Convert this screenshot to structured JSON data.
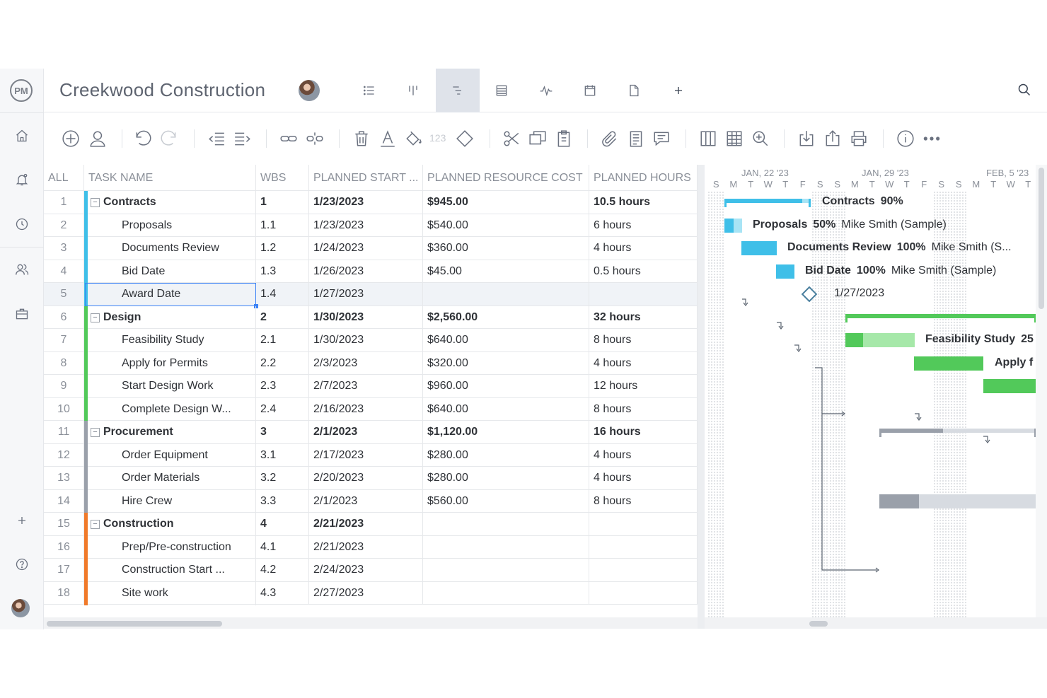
{
  "header": {
    "project_title": "Creekwood Construction"
  },
  "view_tabs": [
    {
      "name": "list-view-icon",
      "active": false
    },
    {
      "name": "board-view-icon",
      "active": false
    },
    {
      "name": "gantt-view-icon",
      "active": true
    },
    {
      "name": "sheet-view-icon",
      "active": false
    },
    {
      "name": "dashboard-view-icon",
      "active": false
    },
    {
      "name": "calendar-view-icon",
      "active": false
    },
    {
      "name": "files-view-icon",
      "active": false
    },
    {
      "name": "add-view-icon",
      "active": false
    }
  ],
  "toolbar": {
    "number_format_label": "123"
  },
  "grid": {
    "columns": [
      "ALL",
      "TASK NAME",
      "WBS",
      "PLANNED START ...",
      "PLANNED RESOURCE COST",
      "PLANNED HOURS"
    ],
    "rows": [
      {
        "num": "1",
        "name": "Contracts",
        "wbs": "1",
        "start": "1/23/2023",
        "cost": "$945.00",
        "hours": "10.5 hours",
        "group": true,
        "color": "#3fbfe8"
      },
      {
        "num": "2",
        "name": "Proposals",
        "wbs": "1.1",
        "start": "1/23/2023",
        "cost": "$540.00",
        "hours": "6 hours",
        "group": false,
        "color": "#3fbfe8"
      },
      {
        "num": "3",
        "name": "Documents Review",
        "wbs": "1.2",
        "start": "1/24/2023",
        "cost": "$360.00",
        "hours": "4 hours",
        "group": false,
        "color": "#3fbfe8"
      },
      {
        "num": "4",
        "name": "Bid Date",
        "wbs": "1.3",
        "start": "1/26/2023",
        "cost": "$45.00",
        "hours": "0.5 hours",
        "group": false,
        "color": "#3fbfe8"
      },
      {
        "num": "5",
        "name": "Award Date",
        "wbs": "1.4",
        "start": "1/27/2023",
        "cost": "",
        "hours": "",
        "group": false,
        "color": "#3fbfe8",
        "selected": true
      },
      {
        "num": "6",
        "name": "Design",
        "wbs": "2",
        "start": "1/30/2023",
        "cost": "$2,560.00",
        "hours": "32 hours",
        "group": true,
        "color": "#52c95a"
      },
      {
        "num": "7",
        "name": "Feasibility Study",
        "wbs": "2.1",
        "start": "1/30/2023",
        "cost": "$640.00",
        "hours": "8 hours",
        "group": false,
        "color": "#52c95a"
      },
      {
        "num": "8",
        "name": "Apply for Permits",
        "wbs": "2.2",
        "start": "2/3/2023",
        "cost": "$320.00",
        "hours": "4 hours",
        "group": false,
        "color": "#52c95a"
      },
      {
        "num": "9",
        "name": "Start Design Work",
        "wbs": "2.3",
        "start": "2/7/2023",
        "cost": "$960.00",
        "hours": "12 hours",
        "group": false,
        "color": "#52c95a"
      },
      {
        "num": "10",
        "name": "Complete Design W...",
        "wbs": "2.4",
        "start": "2/16/2023",
        "cost": "$640.00",
        "hours": "8 hours",
        "group": false,
        "color": "#52c95a"
      },
      {
        "num": "11",
        "name": "Procurement",
        "wbs": "3",
        "start": "2/1/2023",
        "cost": "$1,120.00",
        "hours": "16 hours",
        "group": true,
        "color": "#9aa0aa"
      },
      {
        "num": "12",
        "name": "Order Equipment",
        "wbs": "3.1",
        "start": "2/17/2023",
        "cost": "$280.00",
        "hours": "4 hours",
        "group": false,
        "color": "#9aa0aa"
      },
      {
        "num": "13",
        "name": "Order Materials",
        "wbs": "3.2",
        "start": "2/20/2023",
        "cost": "$280.00",
        "hours": "4 hours",
        "group": false,
        "color": "#9aa0aa"
      },
      {
        "num": "14",
        "name": "Hire Crew",
        "wbs": "3.3",
        "start": "2/1/2023",
        "cost": "$560.00",
        "hours": "8 hours",
        "group": false,
        "color": "#9aa0aa"
      },
      {
        "num": "15",
        "name": "Construction",
        "wbs": "4",
        "start": "2/21/2023",
        "cost": "",
        "hours": "",
        "group": true,
        "color": "#f07a2a"
      },
      {
        "num": "16",
        "name": "Prep/Pre-construction",
        "wbs": "4.1",
        "start": "2/21/2023",
        "cost": "",
        "hours": "",
        "group": false,
        "color": "#f07a2a"
      },
      {
        "num": "17",
        "name": "Construction Start ...",
        "wbs": "4.2",
        "start": "2/24/2023",
        "cost": "",
        "hours": "",
        "group": false,
        "color": "#f07a2a"
      },
      {
        "num": "18",
        "name": "Site work",
        "wbs": "4.3",
        "start": "2/27/2023",
        "cost": "",
        "hours": "",
        "group": false,
        "color": "#f07a2a"
      }
    ]
  },
  "gantt": {
    "weeks": [
      "JAN, 22 '23",
      "JAN, 29 '23",
      "FEB, 5 '23"
    ],
    "days": [
      "S",
      "M",
      "T",
      "W",
      "T",
      "F",
      "S",
      "S",
      "M",
      "T",
      "W",
      "T",
      "F",
      "S",
      "S",
      "M",
      "T",
      "W",
      "T"
    ],
    "labels": [
      {
        "row": 0,
        "task": "Contracts",
        "pct": "90%",
        "owner": ""
      },
      {
        "row": 1,
        "task": "Proposals",
        "pct": "50%",
        "owner": "Mike Smith (Sample)"
      },
      {
        "row": 2,
        "task": "Documents Review",
        "pct": "100%",
        "owner": "Mike Smith (S..."
      },
      {
        "row": 3,
        "task": "Bid Date",
        "pct": "100%",
        "owner": "Mike Smith (Sample)"
      },
      {
        "row": 4,
        "task": "1/27/2023",
        "pct": "",
        "owner": ""
      },
      {
        "row": 6,
        "task": "Feasibility Study",
        "pct": "25",
        "owner": ""
      },
      {
        "row": 7,
        "task": "Apply f",
        "pct": "",
        "owner": ""
      }
    ],
    "colors": {
      "contracts": "#3fbfe8",
      "contracts_light": "#a8e4f5",
      "design": "#52c95a",
      "design_light": "#a6e8a9",
      "procurement": "#9aa0aa",
      "procurement_light": "#d7dbe1",
      "milestone": "#4a7f9e"
    }
  }
}
